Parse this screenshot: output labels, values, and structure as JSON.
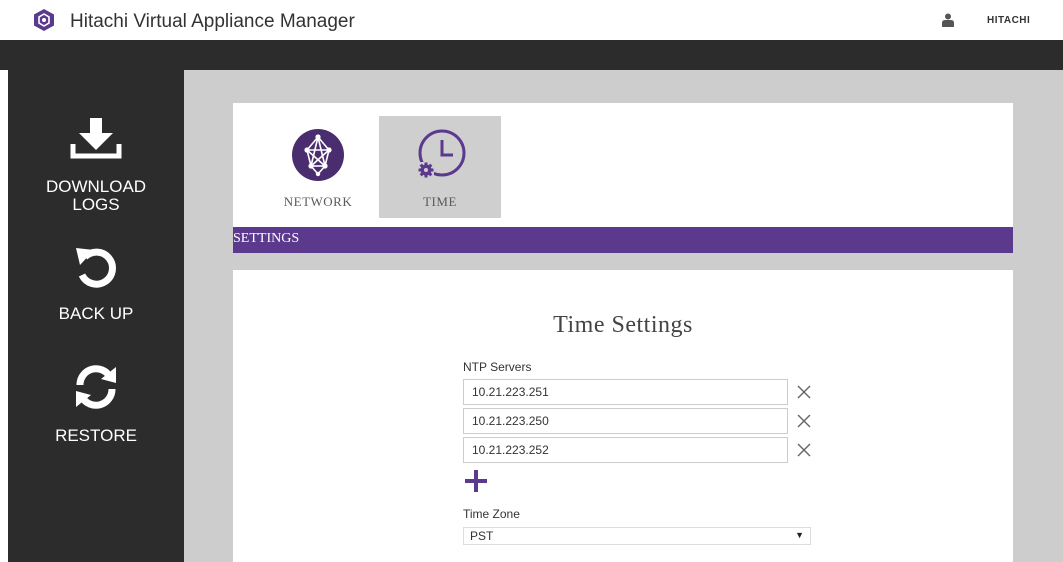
{
  "header": {
    "app_title": "Hitachi Virtual Appliance Manager",
    "brand": "HITACHI",
    "logo_icon": "hexagon-logo-icon",
    "user_icon": "user-icon",
    "accent_color": "#5b3a8e"
  },
  "sidebar": {
    "items": [
      {
        "label_line1": "DOWNLOAD",
        "label_line2": "LOGS",
        "icon": "download-icon"
      },
      {
        "label_line1": "BACK UP",
        "icon": "undo-arrow-icon"
      },
      {
        "label_line1": "RESTORE",
        "icon": "refresh-icon"
      }
    ]
  },
  "tabs": [
    {
      "label": "NETWORK",
      "icon": "network-globe-icon",
      "selected": false
    },
    {
      "label": "TIME",
      "icon": "clock-gear-icon",
      "selected": true
    }
  ],
  "settings_bar": {
    "label": "SETTINGS"
  },
  "time_settings": {
    "title": "Time Settings",
    "ntp_label": "NTP Servers",
    "ntp_servers": [
      "10.21.223.251",
      "10.21.223.250",
      "10.21.223.252"
    ],
    "timezone_label": "Time Zone",
    "timezone_value": "PST"
  }
}
